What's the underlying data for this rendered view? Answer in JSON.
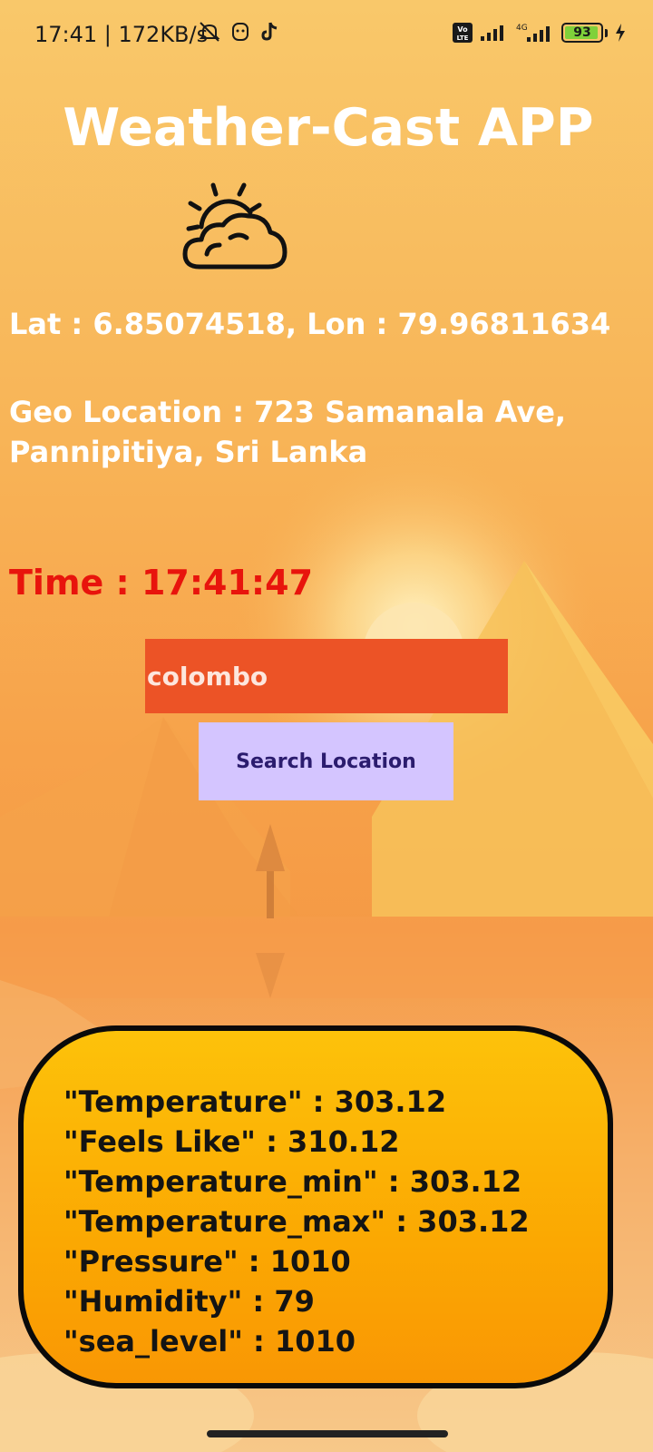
{
  "status_bar": {
    "time": "17:41 | 172KB/s",
    "network_label": "4G",
    "volte_label": "Vo LTE",
    "battery_level": "93",
    "icons": [
      "mute-bell-icon",
      "face-icon",
      "tiktok-icon",
      "signal-icon",
      "signal-icon",
      "battery-icon",
      "charging-icon"
    ]
  },
  "app": {
    "title": "Weather-Cast APP",
    "weather_icon": "sun-behind-cloud-icon"
  },
  "location": {
    "coords": "Lat : 6.85074518, Lon : 79.96811634",
    "geo_line1": "Geo Location : 723 Samanala Ave,",
    "geo_line2": "Pannipitiya, Sri Lanka"
  },
  "time_text": "Time : 17:41:47",
  "search": {
    "value": "colombo",
    "button_label": "Search Location"
  },
  "results": [
    "\"Temperature\" : 303.12",
    "\"Feels Like\" : 310.12",
    "\"Temperature_min\" : 303.12",
    "\"Temperature_max\" : 303.12",
    "\"Pressure\" : 1010",
    "\"Humidity\" : 79",
    "\"sea_level\" : 1010"
  ],
  "colors": {
    "time_text": "#e8140c",
    "search_input_bg": "#ec5326",
    "search_button_bg": "#d4c5ff",
    "result_box_bg": "#fdc20a"
  }
}
